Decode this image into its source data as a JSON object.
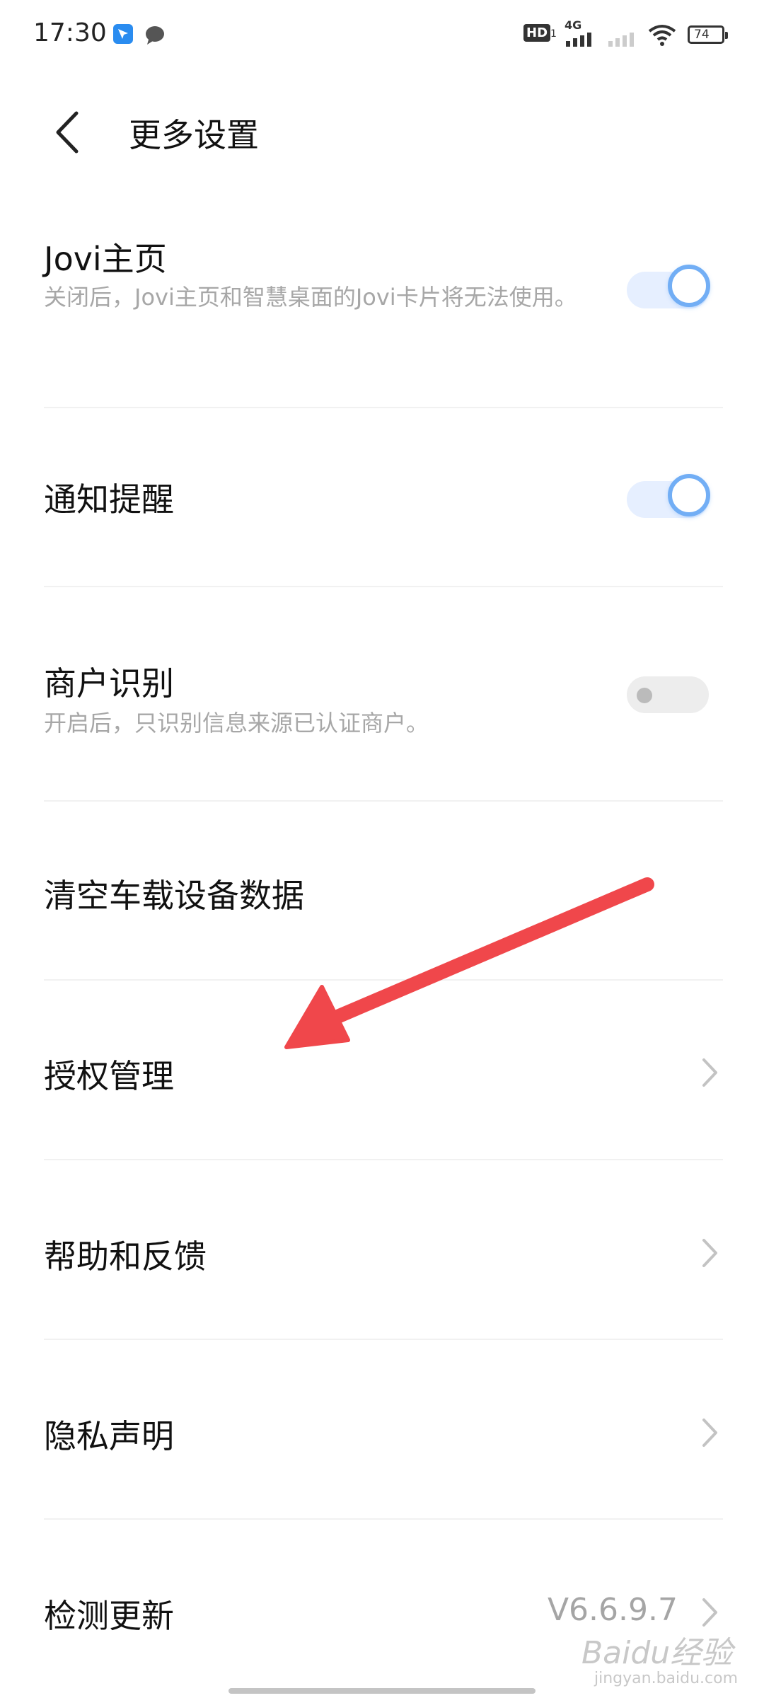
{
  "status_bar": {
    "time": "17:30",
    "hd_label": "HD",
    "hd_sub": "1",
    "network": "4G",
    "battery": "74",
    "icons": [
      "navigation-app-icon",
      "message-icon",
      "hd-icon",
      "signal-icon",
      "wifi-icon",
      "battery-icon"
    ]
  },
  "header": {
    "title": "更多设置",
    "back_icon": "chevron-left-icon"
  },
  "settings": {
    "jovi": {
      "title": "Jovi主页",
      "desc": "关闭后，Jovi主页和智慧桌面的Jovi卡片将无法使用。",
      "enabled": true
    },
    "notify": {
      "title": "通知提醒",
      "enabled": true
    },
    "merchant": {
      "title": "商户识别",
      "desc": "开启后，只识别信息来源已认证商户。",
      "enabled": false
    },
    "clear_car": {
      "title": "清空车载设备数据"
    },
    "auth": {
      "title": "授权管理"
    },
    "help": {
      "title": "帮助和反馈"
    },
    "privacy": {
      "title": "隐私声明"
    },
    "update": {
      "title": "检测更新",
      "version": "V6.6.9.7"
    }
  },
  "watermark": {
    "text": "Baidu经验",
    "sub": "jingyan.baidu.com"
  },
  "colors": {
    "accent": "#72aef5",
    "toggle_on_track": "#e6efff",
    "arrow": "#f0474b"
  }
}
